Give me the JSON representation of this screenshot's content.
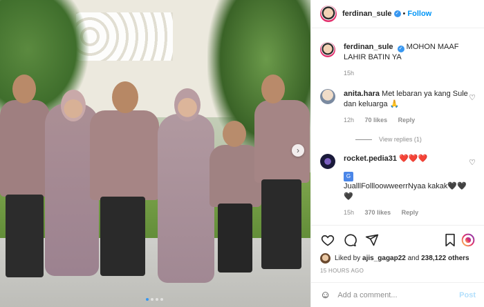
{
  "post": {
    "username": "ferdinan_sule",
    "follow_label": "Follow",
    "separator": "•",
    "caption": "MOHON MAAF LAHIR BATIN YA",
    "caption_time": "15h",
    "likes_prefix": "Liked by",
    "liked_by_user": "ajis_gagap22",
    "likes_conjunction": "and",
    "likes_count": "238,122 others",
    "time_ago": "15 HOURS AGO"
  },
  "comments": [
    {
      "username": "anita.hara",
      "text": "Met lebaran ya kang Sule dan keluarga 🙏",
      "time": "12h",
      "likes": "70 likes",
      "reply_label": "Reply",
      "view_replies": "View replies (1)"
    },
    {
      "username": "rocket.pedia31",
      "text_top": "❤️❤️❤️",
      "text_bottom": "JualllFollloowweerrNyaa kakak🖤🖤🖤",
      "time": "15h",
      "likes": "370 likes",
      "reply_label": "Reply"
    }
  ],
  "add_comment": {
    "placeholder": "Add a comment...",
    "post_label": "Post"
  },
  "icons": {
    "like": "heart-icon",
    "comment": "comment-icon",
    "share": "share-icon",
    "save": "bookmark-icon",
    "emoji": "emoji-icon",
    "next": "chevron-right-icon",
    "translate": "translate-icon"
  },
  "colors": {
    "link_blue": "#0095f6",
    "verified_blue": "#3897f0",
    "muted_text": "#8e8e8e",
    "post_disabled": "#b2dffc"
  }
}
